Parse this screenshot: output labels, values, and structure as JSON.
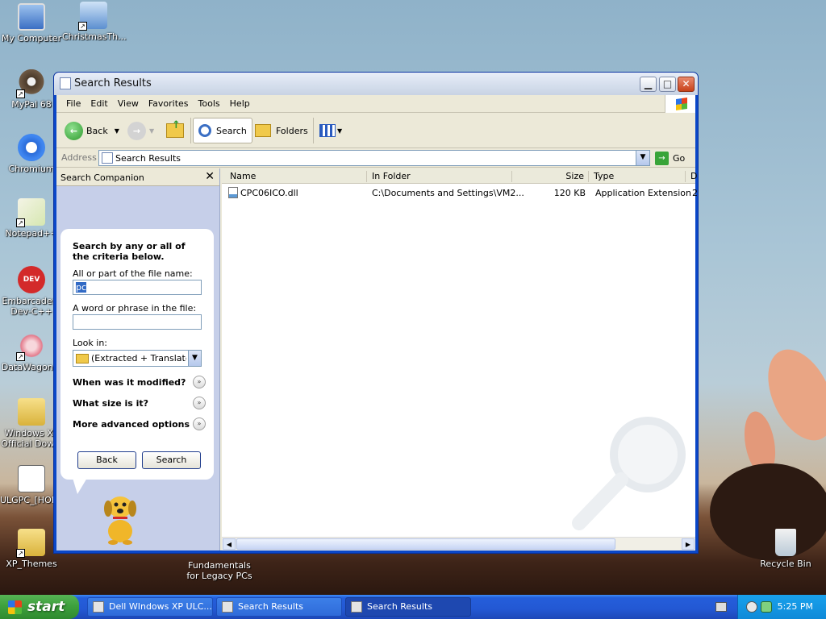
{
  "desktop": {
    "icons": [
      {
        "label": "My Computer",
        "name": "my-computer"
      },
      {
        "label": "ChristmasTh...",
        "name": "christmas"
      },
      {
        "label": "MyPal 68",
        "name": "mypal"
      },
      {
        "label": "Chromium",
        "name": "chromium"
      },
      {
        "label": "Notepad++",
        "name": "notepadpp"
      },
      {
        "label": "Embarcadero Dev-C++",
        "name": "devcpp"
      },
      {
        "label": "DataWagon...",
        "name": "datawagon"
      },
      {
        "label": "Windows XP Official Dow...",
        "name": "winxp-download"
      },
      {
        "label": "ULGPC_[HOM...",
        "name": "ulgpc"
      },
      {
        "label": "XP_Themes",
        "name": "xp-themes"
      },
      {
        "label": "Recycle Bin",
        "name": "recycle-bin"
      }
    ],
    "wallpaper_text": "Fundamentals for Legacy PCs"
  },
  "window": {
    "title": "Search Results",
    "menu": [
      "File",
      "Edit",
      "View",
      "Favorites",
      "Tools",
      "Help"
    ],
    "toolbar": {
      "back": "Back",
      "search": "Search",
      "folders": "Folders"
    },
    "address": {
      "label": "Address",
      "value": "Search Results",
      "go": "Go"
    }
  },
  "companion": {
    "title": "Search Companion",
    "heading": "Search by any or all of the criteria below.",
    "filename_label": "All or part of the file name:",
    "filename_value": "pc",
    "phrase_label": "A word or phrase in the file:",
    "phrase_value": "",
    "lookin_label": "Look in:",
    "lookin_value": "(Extracted + Translated)",
    "expanders": [
      "When was it modified?",
      "What size is it?",
      "More advanced options"
    ],
    "back_button": "Back",
    "search_button": "Search"
  },
  "results": {
    "columns": [
      "Name",
      "In Folder",
      "Size",
      "Type",
      "D"
    ],
    "rows": [
      {
        "name": "CPC06ICO.dll",
        "folder": "C:\\Documents and Settings\\VM2...",
        "size": "120 KB",
        "type": "Application Extension",
        "date": "2"
      }
    ]
  },
  "taskbar": {
    "start": "start",
    "tasks": [
      {
        "label": "Dell WIndows XP ULC..."
      },
      {
        "label": "Search Results"
      },
      {
        "label": "Search Results",
        "active": true
      }
    ],
    "clock": "5:25 PM"
  },
  "colors": {
    "titlebar": "#d7e0ee",
    "taskbar": "#245edb",
    "start": "#3c9f3c",
    "companion": "#c6cfe9"
  }
}
